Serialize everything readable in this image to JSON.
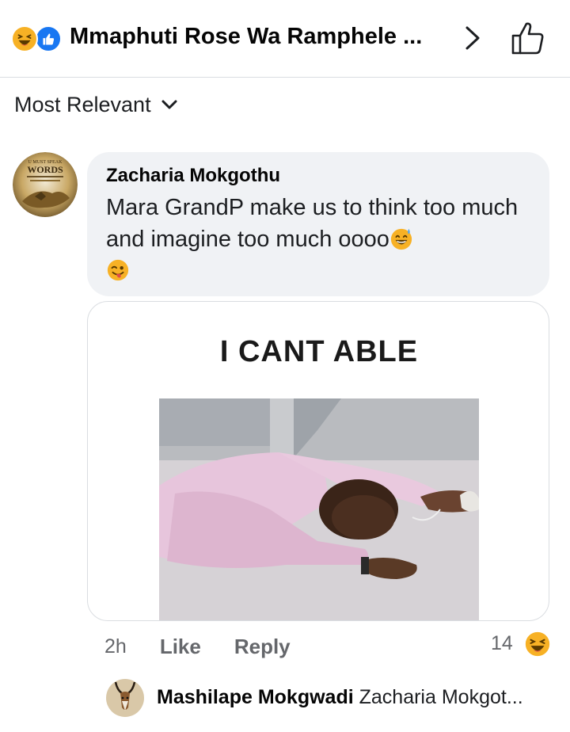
{
  "header": {
    "title": "Mmaphuti Rose Wa Ramphele ...",
    "reaction_icons": [
      "haha-icon",
      "like-icon"
    ]
  },
  "sort": {
    "label": "Most Relevant"
  },
  "comment": {
    "author": "Zacharia Mokgothu",
    "text": "Mara GrandP make us to think too much and imagine too much oooo",
    "emojis": [
      "sweat-smile-emoji",
      "winking-tongue-emoji"
    ],
    "avatar_text": [
      "U MUST SPEAK",
      "WORDS"
    ],
    "image": {
      "caption": "I CANT ABLE"
    },
    "time": "2h",
    "like_label": "Like",
    "reply_label": "Reply",
    "reaction_count": "14",
    "reaction_icon": "haha-icon"
  },
  "reply": {
    "author": "Mashilape Mokgwadi",
    "preview": "Zacharia Mokgot..."
  },
  "colors": {
    "accent": "#1877f2",
    "haha": "#f7b125",
    "bubble": "#f0f2f5",
    "muted_text": "#65676b"
  }
}
